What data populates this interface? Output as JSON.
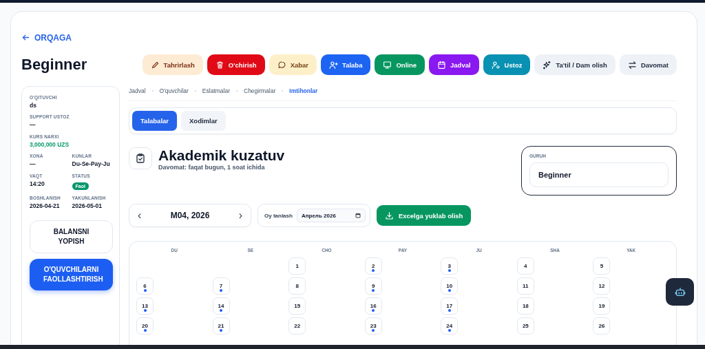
{
  "back_link": {
    "label": "ORQAGA"
  },
  "title": "Beginner",
  "actions": [
    {
      "label": "Tahrirlash",
      "kind": "edit"
    },
    {
      "label": "O'chirish",
      "kind": "delete"
    },
    {
      "label": "Xabar",
      "kind": "message"
    },
    {
      "label": "Talaba",
      "kind": "student"
    },
    {
      "label": "Online",
      "kind": "online"
    },
    {
      "label": "Jadval",
      "kind": "schedule"
    },
    {
      "label": "Ustoz",
      "kind": "teacher"
    },
    {
      "label": "Ta'til / Dam olish",
      "kind": "vacation"
    },
    {
      "label": "Davomat",
      "kind": "attendance"
    }
  ],
  "sidebar": {
    "rows": [
      [
        {
          "label": "O'QITUVCHI",
          "value": "ds",
          "kind": "text"
        }
      ],
      [
        {
          "label": "SUPPORT USTOZ",
          "value": "—",
          "kind": "text"
        }
      ],
      [
        {
          "label": "KURS NARXI",
          "value": "3,000,000 UZS",
          "kind": "price"
        }
      ],
      [
        {
          "label": "XONA",
          "value": "—",
          "kind": "text"
        },
        {
          "label": "KUNLAR",
          "value": "Du-Se-Pay-Ju",
          "kind": "text"
        }
      ],
      [
        {
          "label": "VAQT",
          "value": "14:20",
          "kind": "text"
        },
        {
          "label": "STATUS",
          "value": "Faol",
          "kind": "badge"
        }
      ],
      [
        {
          "label": "BOSHLANISH",
          "value": "2026-04-21",
          "kind": "text"
        },
        {
          "label": "YAKUNLANISH",
          "value": "2026-05-01",
          "kind": "text"
        }
      ]
    ],
    "buttons": [
      {
        "label": "BALANSNI YOPISH",
        "kind": "outline"
      },
      {
        "label": "O'QUVCHILARNI FAOLLASHTIRISH",
        "kind": "primary"
      }
    ]
  },
  "nav_tabs": [
    {
      "label": "Jadval",
      "selected": false
    },
    {
      "label": "O'quvchilar",
      "selected": false
    },
    {
      "label": "Eslatmalar",
      "selected": false
    },
    {
      "label": "Chegirmalar",
      "selected": false
    },
    {
      "label": "Imtihonlar",
      "selected": true
    }
  ],
  "sub_tabs": [
    {
      "label": "Talabalar",
      "selected": true
    },
    {
      "label": "Xodimlar",
      "selected": false
    }
  ],
  "section": {
    "title": "Akademik kuzatuv",
    "subtitle": "Davomat: faqat bugun, 1 soat ichida"
  },
  "group": {
    "label": "GURUH",
    "value": "Beginner"
  },
  "month_nav": {
    "label": "M04, 2026",
    "prev": "‹",
    "next": "›"
  },
  "month_picker": {
    "label": "Oy tanlash",
    "value": "Апрель 2026"
  },
  "export_button": {
    "label": "Excelga yuklab olish"
  },
  "calendar": {
    "weekdays": [
      "DU",
      "SE",
      "CHO",
      "PAY",
      "JU",
      "SHA",
      "YAK"
    ],
    "weeks": [
      [
        {
          "day": "1",
          "marked": false
        },
        {
          "day": "2",
          "marked": true
        },
        {
          "day": "3",
          "marked": true
        },
        {
          "day": "4",
          "marked": false
        },
        {
          "day": "5",
          "marked": false
        }
      ],
      [
        {
          "day": "6",
          "marked": true
        },
        {
          "day": "7",
          "marked": true
        },
        {
          "day": "8",
          "marked": false
        },
        {
          "day": "9",
          "marked": true
        },
        {
          "day": "10",
          "marked": true
        },
        {
          "day": "11",
          "marked": false
        },
        {
          "day": "12",
          "marked": false
        }
      ],
      [
        {
          "day": "13",
          "marked": true
        },
        {
          "day": "14",
          "marked": true
        },
        {
          "day": "15",
          "marked": false
        },
        {
          "day": "16",
          "marked": true
        },
        {
          "day": "17",
          "marked": true
        },
        {
          "day": "18",
          "marked": false
        },
        {
          "day": "19",
          "marked": false
        }
      ],
      [
        {
          "day": "20",
          "marked": true
        },
        {
          "day": "21",
          "marked": true
        },
        {
          "day": "22",
          "marked": false
        },
        {
          "day": "23",
          "marked": true
        },
        {
          "day": "24",
          "marked": true
        },
        {
          "day": "25",
          "marked": false
        },
        {
          "day": "26",
          "marked": false
        }
      ]
    ]
  }
}
